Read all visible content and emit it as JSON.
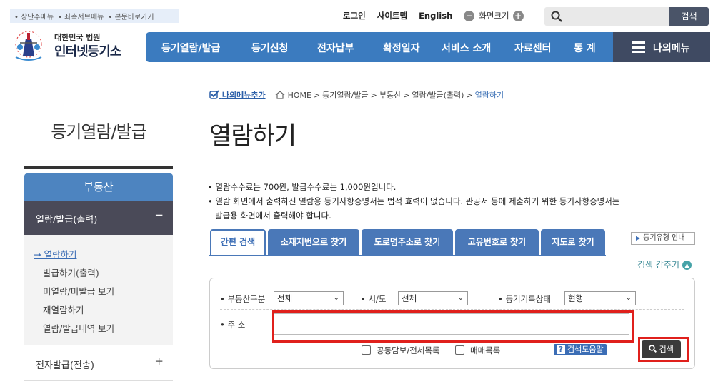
{
  "skipnav": [
    "상단주메뉴",
    "좌측서브메뉴",
    "본문바로가기"
  ],
  "utility": {
    "login": "로그인",
    "sitemap": "사이트맵",
    "english": "English",
    "zoom_out": "−",
    "font_size": "화면크기",
    "zoom_in": "+"
  },
  "top_search": {
    "placeholder": "",
    "button": "검색"
  },
  "logo": {
    "line1": "대한민국 법원",
    "line2": "인터넷등기소"
  },
  "gnb": [
    "등기열람/발급",
    "등기신청",
    "전자납부",
    "확정일자",
    "서비스 소개",
    "자료센터",
    "통 계"
  ],
  "my_menu": "나의메뉴",
  "lnb": {
    "title": "등기열람/발급",
    "header": "부동산",
    "section": "열람/발급(출력)",
    "section_toggle": "−",
    "items": [
      "열람하기",
      "발급하기(출력)",
      "미열람/미발급 보기",
      "재열람하기",
      "열람/발급내역 보기"
    ],
    "current_marker": "→",
    "section2": "전자발급(전송)",
    "section2_toggle": "+"
  },
  "breadcrumb": {
    "add_menu": "나의메뉴추가",
    "path": [
      "HOME",
      "등기열람/발급",
      "부동산",
      "열람/발급(출력)"
    ],
    "current": "열람하기",
    "separator": ">"
  },
  "page_title": "열람하기",
  "notes": [
    "열람수수료는 700원, 발급수수료는 1,000원입니다.",
    "열람 화면에서 출력하신 열람용 등기사항증명서는 법적 효력이 없습니다. 관공서 등에 제출하기 위한 등기사항증명서는",
    "발급용 화면에서 출력해야 합니다."
  ],
  "tabs": [
    "간편 검색",
    "소재지번으로 찾기",
    "도로명주소로 찾기",
    "고유번호로 찾기",
    "지도로 찾기"
  ],
  "guide_button": "등기유형 안내",
  "fold_label": "검색 감추기",
  "form": {
    "property_type": {
      "label": "부동산구분",
      "value": "전체"
    },
    "region": {
      "label": "시/도",
      "value": "전체"
    },
    "record_status": {
      "label": "등기기록상태",
      "value": "현행"
    },
    "address": {
      "label": "주 소",
      "value": ""
    },
    "check1": "공동담보/전세목록",
    "check2": "매매목록",
    "help": "검색도움말",
    "search": "검색"
  },
  "colors": {
    "gnb": "#3b7bbf",
    "my_menu": "#3f4a62",
    "tab": "#4a78b8",
    "highlight": "#e0201c"
  }
}
